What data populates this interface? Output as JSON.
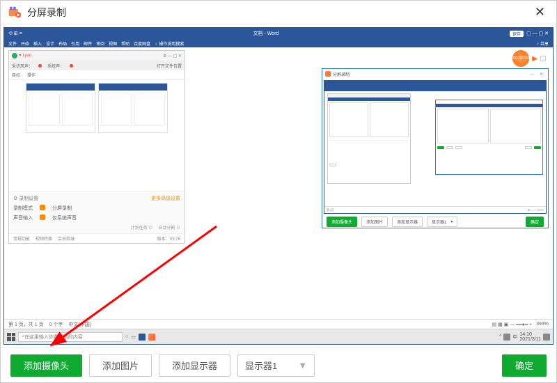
{
  "window": {
    "title": "分屏录制",
    "close": "✕"
  },
  "word": {
    "title": "文档 - Word",
    "save_btn": "保存",
    "share_btn": "共享",
    "win_controls": "▢  —  ▢  ✕",
    "ribbon": [
      "文件",
      "开始",
      "插入",
      "设计",
      "布局",
      "引用",
      "邮件",
      "审阅",
      "视图",
      "帮助",
      "百度网盘"
    ],
    "ribbon_search": "操作说明搜索",
    "statusbar_left": [
      "第 1 页，共 1 页",
      "0 个字",
      "中文(中国)"
    ],
    "zoom": "393%"
  },
  "rec": {
    "time": "00:00:00"
  },
  "app1": {
    "user": "Lyan",
    "win_controls": "⚙  —  ▢  ✕",
    "toolbar": {
      "label1": "采访风声：",
      "label2": "系统声：",
      "label3": "打开文件位置"
    },
    "tabs": [
      "目标",
      "操作"
    ],
    "settings_header": "录制设置",
    "settings_header_right": "更多高级设置",
    "rows": [
      {
        "label": "录制模式",
        "value": "分屏录制"
      },
      {
        "label": "声音输入",
        "value": "仅系统声音"
      }
    ],
    "footer": [
      "计划任务 ⊙",
      "自动分割 ⊙"
    ],
    "bottom": [
      "常规功能",
      "视频转换",
      "会员商城"
    ],
    "version": "版本：V5.76"
  },
  "app2": {
    "title": "分屏录制",
    "buttons": [
      "添加摄像头",
      "添加图片",
      "添加显示器"
    ],
    "select": "显示器1",
    "confirm": "确定"
  },
  "taskbar": {
    "search_placeholder": "在这里输入你要搜索的内容",
    "time": "14:10",
    "date": "2021/3/11"
  },
  "bottom": {
    "add_camera": "添加摄像头",
    "add_image": "添加图片",
    "add_display": "添加显示器",
    "display_select": "显示器1",
    "confirm": "确定"
  }
}
